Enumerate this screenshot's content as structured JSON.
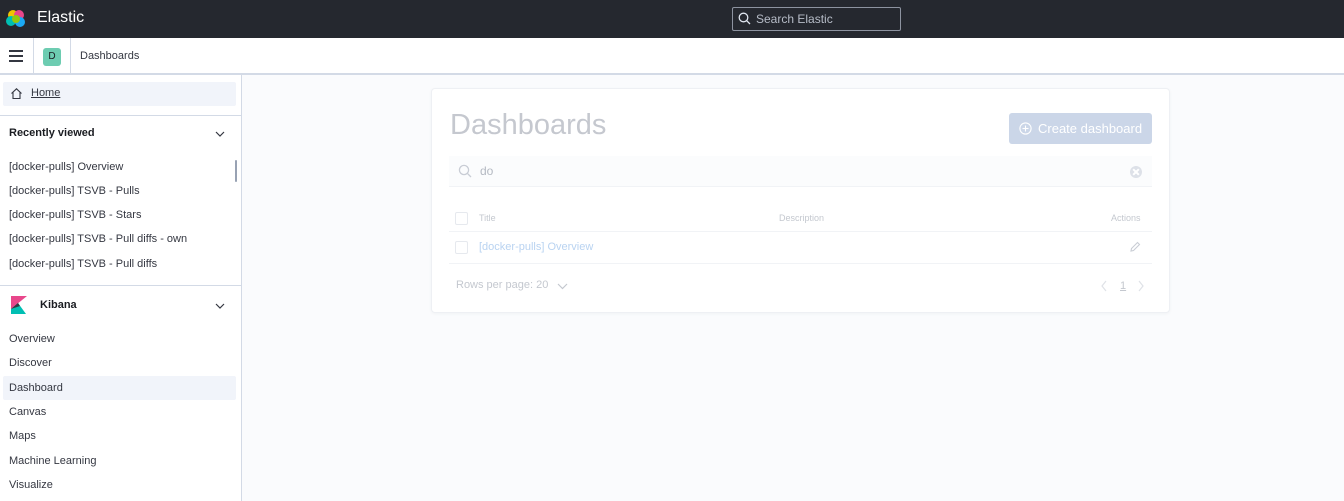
{
  "header": {
    "brand": "Elastic",
    "search_placeholder": "Search Elastic"
  },
  "subheader": {
    "space_initial": "D",
    "breadcrumb": "Dashboards"
  },
  "sidebar": {
    "home_label": "Home",
    "recently_viewed": {
      "title": "Recently viewed",
      "items": [
        "[docker-pulls] Overview",
        "[docker-pulls] TSVB - Pulls",
        "[docker-pulls] TSVB - Stars",
        "[docker-pulls] TSVB - Pull diffs - own",
        "[docker-pulls] TSVB - Pull diffs"
      ]
    },
    "kibana": {
      "title": "Kibana",
      "items": [
        "Overview",
        "Discover",
        "Dashboard",
        "Canvas",
        "Maps",
        "Machine Learning",
        "Visualize"
      ],
      "active": "Dashboard"
    }
  },
  "main": {
    "title": "Dashboards",
    "create_button": "Create dashboard",
    "search_value": "do",
    "columns": {
      "title": "Title",
      "description": "Description",
      "actions": "Actions"
    },
    "rows": [
      {
        "title": "[docker-pulls] Overview",
        "description": ""
      }
    ],
    "rows_per_page": "Rows per page: 20",
    "current_page": "1"
  }
}
